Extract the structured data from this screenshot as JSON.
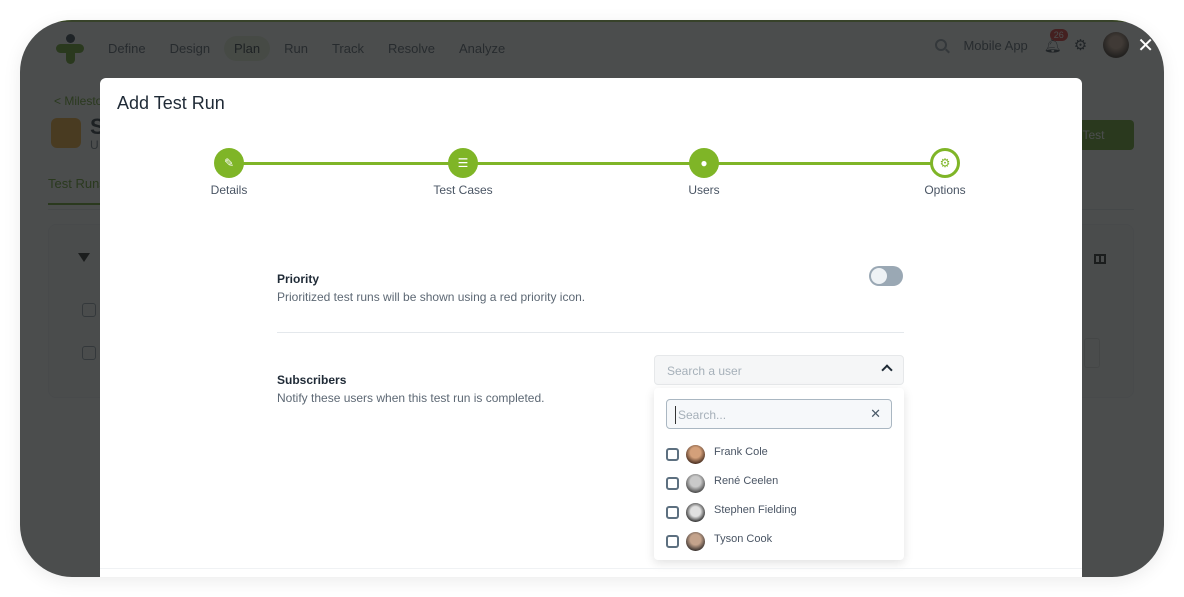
{
  "app": {
    "nav": [
      "Define",
      "Design",
      "Plan",
      "Run",
      "Track",
      "Resolve",
      "Analyze"
    ],
    "active_nav": "Plan",
    "project_name": "Mobile App",
    "notification_count": "26",
    "icons": {
      "search": "search-icon",
      "bell": "bell-icon",
      "gear": "gear-icon",
      "close": "close-icon"
    },
    "background_page": {
      "breadcrumb": "< Milestones",
      "title": "S",
      "subtitle": "U",
      "tab": "Test Runs",
      "add_button": "Add Test Run..."
    },
    "accent_color": "#7fb527"
  },
  "modal": {
    "title": "Add Test Run",
    "steps": [
      {
        "label": "Details",
        "icon": "edit-icon",
        "state": "done"
      },
      {
        "label": "Test Cases",
        "icon": "list-icon",
        "state": "done"
      },
      {
        "label": "Users",
        "icon": "user-icon",
        "state": "done"
      },
      {
        "label": "Options",
        "icon": "gear-icon",
        "state": "current"
      }
    ],
    "priority": {
      "title": "Priority",
      "description": "Prioritized test runs will be shown using a red priority icon.",
      "enabled": false
    },
    "subscribers": {
      "title": "Subscribers",
      "description": "Notify these users when this test run is completed.",
      "select_placeholder": "Search a user",
      "search_placeholder": "Search...",
      "search_value": "",
      "users": [
        {
          "name": "Frank Cole",
          "checked": false
        },
        {
          "name": "René Ceelen",
          "checked": false
        },
        {
          "name": "Stephen Fielding",
          "checked": false
        },
        {
          "name": "Tyson Cook",
          "checked": false
        }
      ]
    }
  }
}
